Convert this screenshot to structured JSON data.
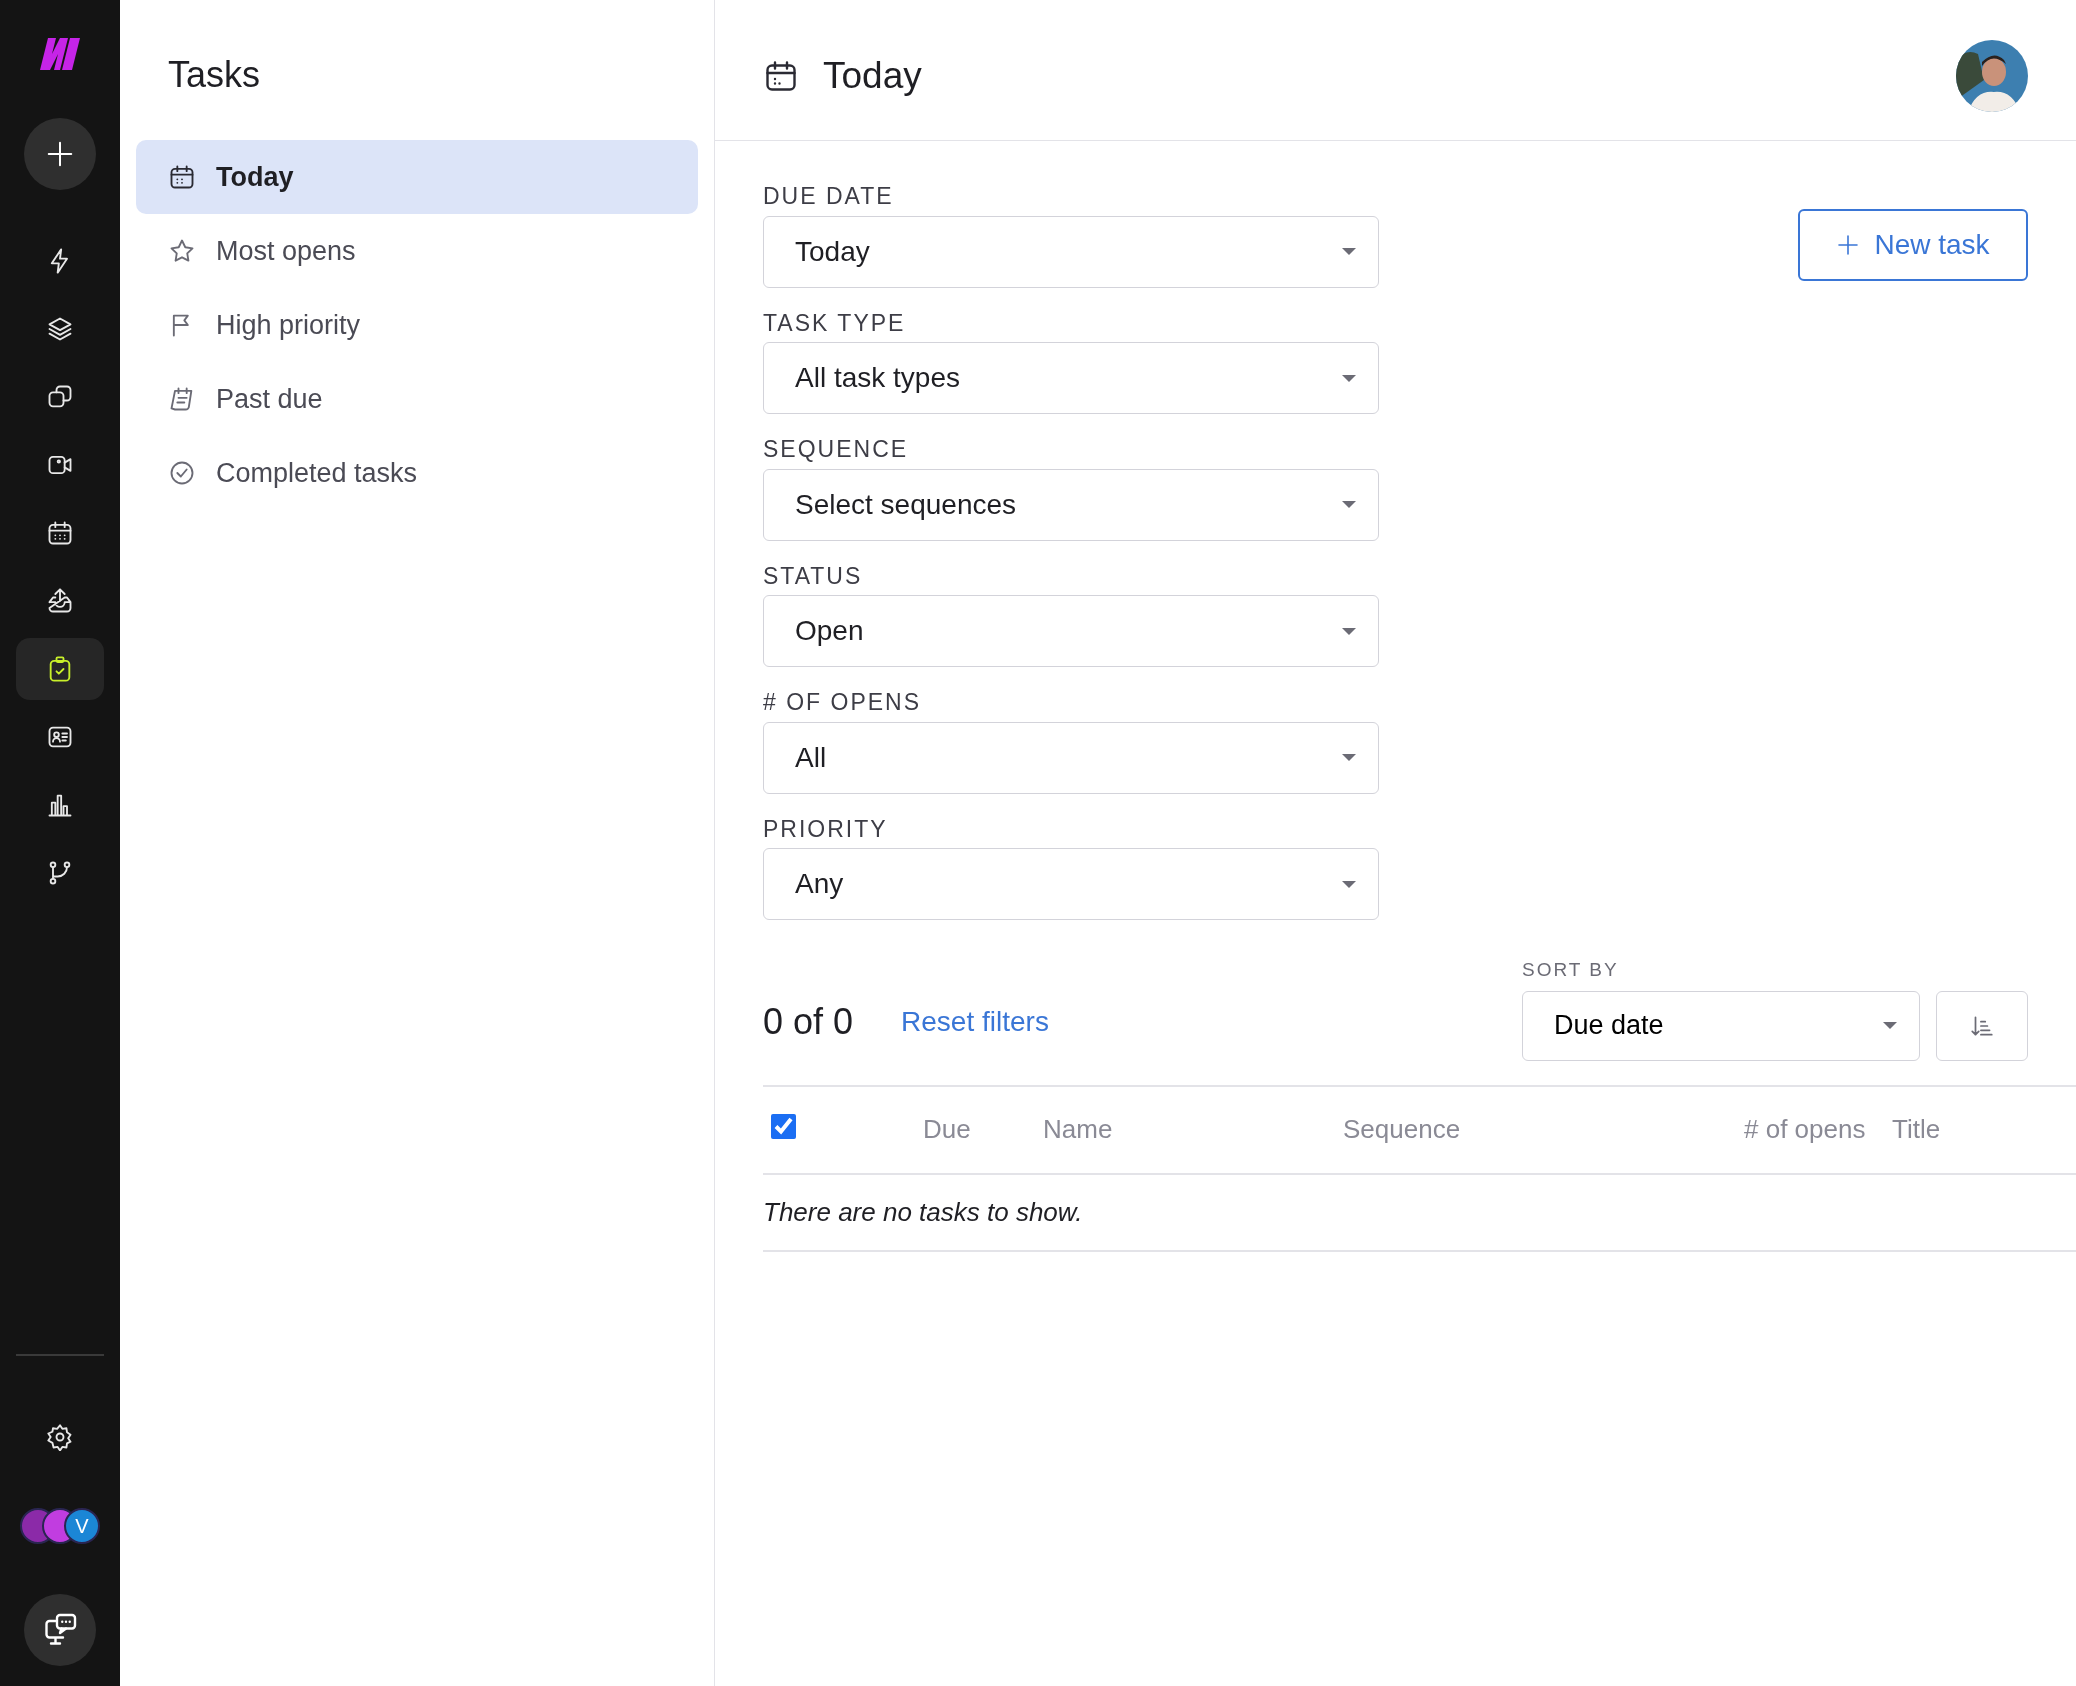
{
  "rail": {
    "items": [
      {
        "selected": false
      },
      {
        "selected": false
      },
      {
        "selected": false
      },
      {
        "selected": false
      },
      {
        "selected": false
      },
      {
        "selected": false
      },
      {
        "selected": true
      },
      {
        "selected": false
      },
      {
        "selected": false
      },
      {
        "selected": false
      }
    ],
    "avatar_letter": "V"
  },
  "sidebar": {
    "title": "Tasks",
    "items": [
      {
        "label": "Today",
        "selected": true
      },
      {
        "label": "Most opens",
        "selected": false
      },
      {
        "label": "High priority",
        "selected": false
      },
      {
        "label": "Past due",
        "selected": false
      },
      {
        "label": "Completed tasks",
        "selected": false
      }
    ]
  },
  "header": {
    "title": "Today"
  },
  "filters": [
    {
      "label": "DUE DATE",
      "value": "Today"
    },
    {
      "label": "TASK TYPE",
      "value": "All task types"
    },
    {
      "label": "SEQUENCE",
      "value": "Select sequences"
    },
    {
      "label": "STATUS",
      "value": "Open"
    },
    {
      "label": "# OF OPENS",
      "value": "All"
    },
    {
      "label": "PRIORITY",
      "value": "Any"
    }
  ],
  "new_task_button": "New task",
  "count": "0 of 0",
  "reset_link": "Reset filters",
  "sort": {
    "label": "SORT BY",
    "value": "Due date"
  },
  "table": {
    "select_all_checked": true,
    "columns": [
      "Due",
      "Name",
      "Sequence",
      "# of opens",
      "Title"
    ],
    "empty_message": "There are no tasks to show."
  }
}
